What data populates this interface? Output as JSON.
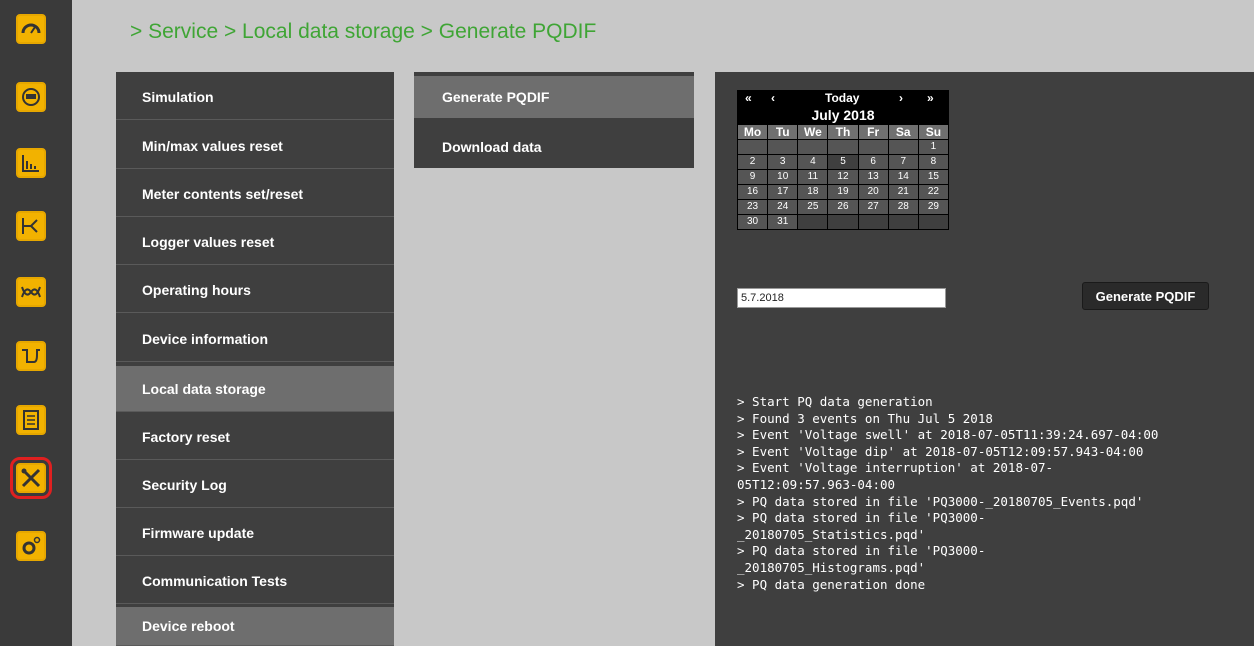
{
  "breadcrumb": "> Service > Local data storage > Generate PQDIF",
  "rail": {
    "items": [
      {
        "icon": "speedometer-icon"
      },
      {
        "icon": "meter-display-icon"
      },
      {
        "icon": "bar-chart-icon"
      },
      {
        "icon": "phasor-diagram-icon"
      },
      {
        "icon": "harmonics-icon"
      },
      {
        "icon": "waveform-icon"
      },
      {
        "icon": "events-list-icon"
      },
      {
        "icon": "service-tools-icon",
        "active": true
      },
      {
        "icon": "settings-gears-icon"
      }
    ],
    "accent_color": "#f2b200",
    "active_frame_color": "#e02020"
  },
  "menu1": {
    "items": [
      {
        "label": "Simulation"
      },
      {
        "label": "Min/max values reset"
      },
      {
        "label": "Meter contents set/reset"
      },
      {
        "label": "Logger values reset"
      },
      {
        "label": "Operating hours"
      },
      {
        "label": "Device information"
      },
      {
        "label": "Local data storage",
        "selected": true
      },
      {
        "label": "Factory reset"
      },
      {
        "label": "Security Log"
      },
      {
        "label": "Firmware update"
      },
      {
        "label": "Communication Tests"
      },
      {
        "label": "Device reboot"
      }
    ]
  },
  "menu2": {
    "items": [
      {
        "label": "Generate PQDIF",
        "selected": true
      },
      {
        "label": "Download data"
      }
    ]
  },
  "calendar": {
    "nav": {
      "prev_year": "«",
      "prev_month": "‹",
      "today": "Today",
      "next_month": "›",
      "next_year": "»"
    },
    "month_label": "July 2018",
    "weekdays": [
      "Mo",
      "Tu",
      "We",
      "Th",
      "Fr",
      "Sa",
      "Su"
    ],
    "days": [
      "1",
      "2",
      "3",
      "4",
      "5",
      "6",
      "7",
      "8",
      "9",
      "10",
      "11",
      "12",
      "13",
      "14",
      "15",
      "16",
      "17",
      "18",
      "19",
      "20",
      "21",
      "22",
      "23",
      "24",
      "25",
      "26",
      "27",
      "28",
      "29",
      "30",
      "31"
    ],
    "selected_day": "5"
  },
  "date_input": {
    "value": "5.7.2018"
  },
  "generate_button": {
    "label": "Generate PQDIF"
  },
  "log": {
    "text": "> Start PQ data generation\n> Found 3 events on Thu Jul 5 2018\n> Event 'Voltage swell' at 2018-07-05T11:39:24.697-04:00\n> Event 'Voltage dip' at 2018-07-05T12:09:57.943-04:00\n> Event 'Voltage interruption' at 2018-07-\n05T12:09:57.963-04:00\n> PQ data stored in file 'PQ3000-_20180705_Events.pqd'\n> PQ data stored in file 'PQ3000-\n_20180705_Statistics.pqd'\n> PQ data stored in file 'PQ3000-\n_20180705_Histograms.pqd'\n> PQ data generation done"
  },
  "colors": {
    "breadcrumb": "#3fa535",
    "content_bg": "#c8c8c8",
    "panel_bg": "#3f3f3f",
    "menu_selected": "#6e6e6e"
  }
}
